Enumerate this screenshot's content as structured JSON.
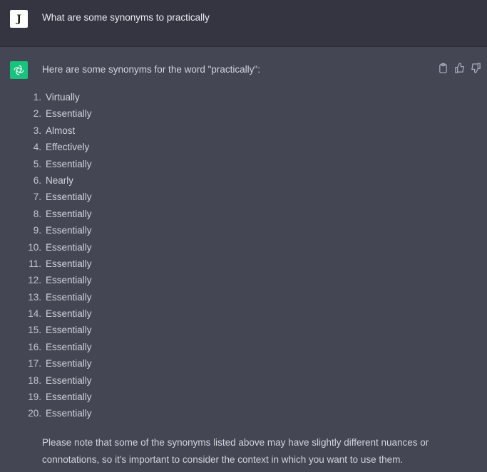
{
  "user_message": {
    "avatar_letter": "J",
    "text": "What are some synonyms to practically"
  },
  "assistant_message": {
    "intro": "Here are some synonyms for the word \"practically\":",
    "actions": [
      "copy-icon",
      "thumbs-up-icon",
      "thumbs-down-icon"
    ],
    "items": [
      {
        "n": "1.",
        "t": "Virtually"
      },
      {
        "n": "2.",
        "t": "Essentially"
      },
      {
        "n": "3.",
        "t": "Almost"
      },
      {
        "n": "4.",
        "t": "Effectively"
      },
      {
        "n": "5.",
        "t": "Essentially"
      },
      {
        "n": "6.",
        "t": "Nearly"
      },
      {
        "n": "7.",
        "t": "Essentially"
      },
      {
        "n": "8.",
        "t": "Essentially"
      },
      {
        "n": "9.",
        "t": "Essentially"
      },
      {
        "n": "10.",
        "t": "Essentially"
      },
      {
        "n": "11.",
        "t": "Essentially"
      },
      {
        "n": "12.",
        "t": "Essentially"
      },
      {
        "n": "13.",
        "t": "Essentially"
      },
      {
        "n": "14.",
        "t": "Essentially"
      },
      {
        "n": "15.",
        "t": "Essentially"
      },
      {
        "n": "16.",
        "t": "Essentially"
      },
      {
        "n": "17.",
        "t": "Essentially"
      },
      {
        "n": "18.",
        "t": "Essentially"
      },
      {
        "n": "19.",
        "t": "Essentially"
      },
      {
        "n": "20.",
        "t": "Essentially"
      }
    ],
    "note": "Please note that some of the synonyms listed above may have slightly different nuances or connotations, so it's important to consider the context in which you want to use them."
  },
  "colors": {
    "user_bg": "#343541",
    "assistant_bg": "#444654",
    "bot_avatar": "#19c37d"
  }
}
